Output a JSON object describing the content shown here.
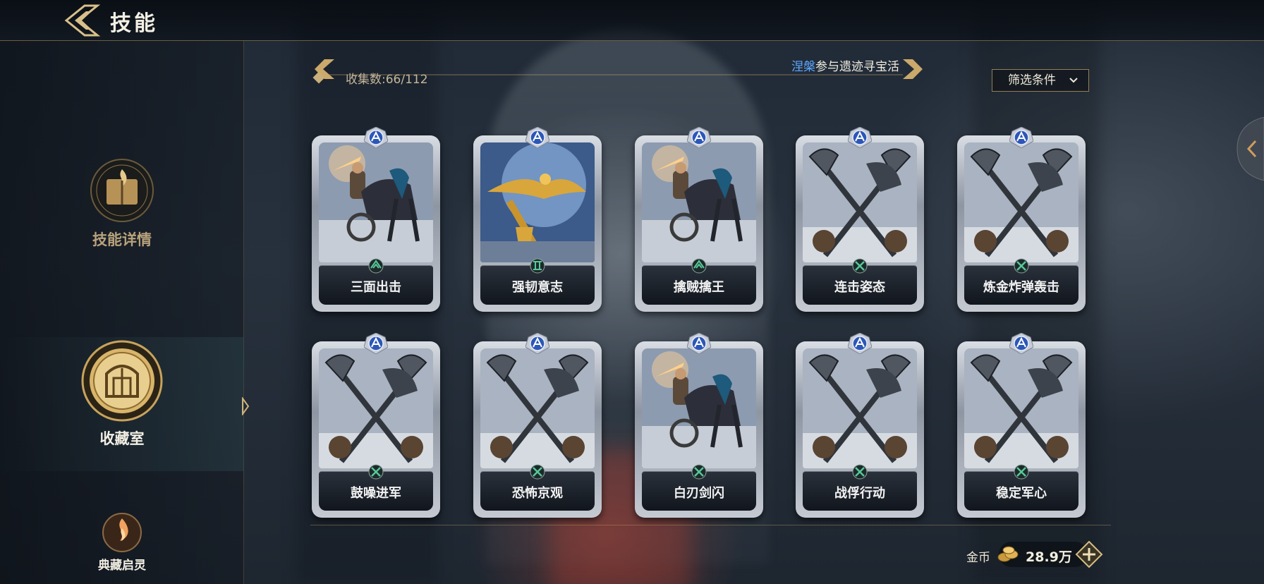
{
  "header": {
    "title": "技能"
  },
  "sidebar": {
    "items": [
      {
        "label": "技能详情",
        "icon": "book-flame-emblem-icon",
        "active": false
      },
      {
        "label": "收藏室",
        "icon": "gallery-gate-emblem-icon",
        "active": true
      },
      {
        "label": "典藏启灵",
        "icon": "spirit-flame-emblem-icon",
        "active": false
      }
    ]
  },
  "collection": {
    "count_text": "收集数:66/112",
    "marquee_highlight": "涅槃",
    "marquee_rest": "参与遗迹寻宝活"
  },
  "filter": {
    "label": "筛选条件",
    "icon": "chevron-down-icon"
  },
  "cards": [
    {
      "name": "三面出击",
      "art": "chariot",
      "type_icon": "rank-emblem-icon"
    },
    {
      "name": "强韧意志",
      "art": "eagle-standard",
      "type_icon": "pillar-emblem-icon"
    },
    {
      "name": "擒贼擒王",
      "art": "chariot",
      "type_icon": "rank-emblem-icon"
    },
    {
      "name": "连击姿态",
      "art": "axes",
      "type_icon": "crossed-weapons-icon"
    },
    {
      "name": "炼金炸弹轰击",
      "art": "axes",
      "type_icon": "crossed-weapons-icon"
    },
    {
      "name": "鼓噪进军",
      "art": "axes",
      "type_icon": "crossed-weapons-icon"
    },
    {
      "name": "恐怖京观",
      "art": "axes",
      "type_icon": "crossed-weapons-icon"
    },
    {
      "name": "白刃剑闪",
      "art": "chariot",
      "type_icon": "crossed-weapons-icon"
    },
    {
      "name": "战俘行动",
      "art": "axes",
      "type_icon": "crossed-weapons-icon"
    },
    {
      "name": "稳定军心",
      "art": "axes",
      "type_icon": "crossed-weapons-icon"
    }
  ],
  "currency": {
    "label": "金币",
    "amount": "28.9万",
    "icon": "gold-coins-icon"
  },
  "colors": {
    "gold": "#c9a766",
    "highlight_blue": "#5ea7ff",
    "card_badge": "#2c57b8"
  }
}
